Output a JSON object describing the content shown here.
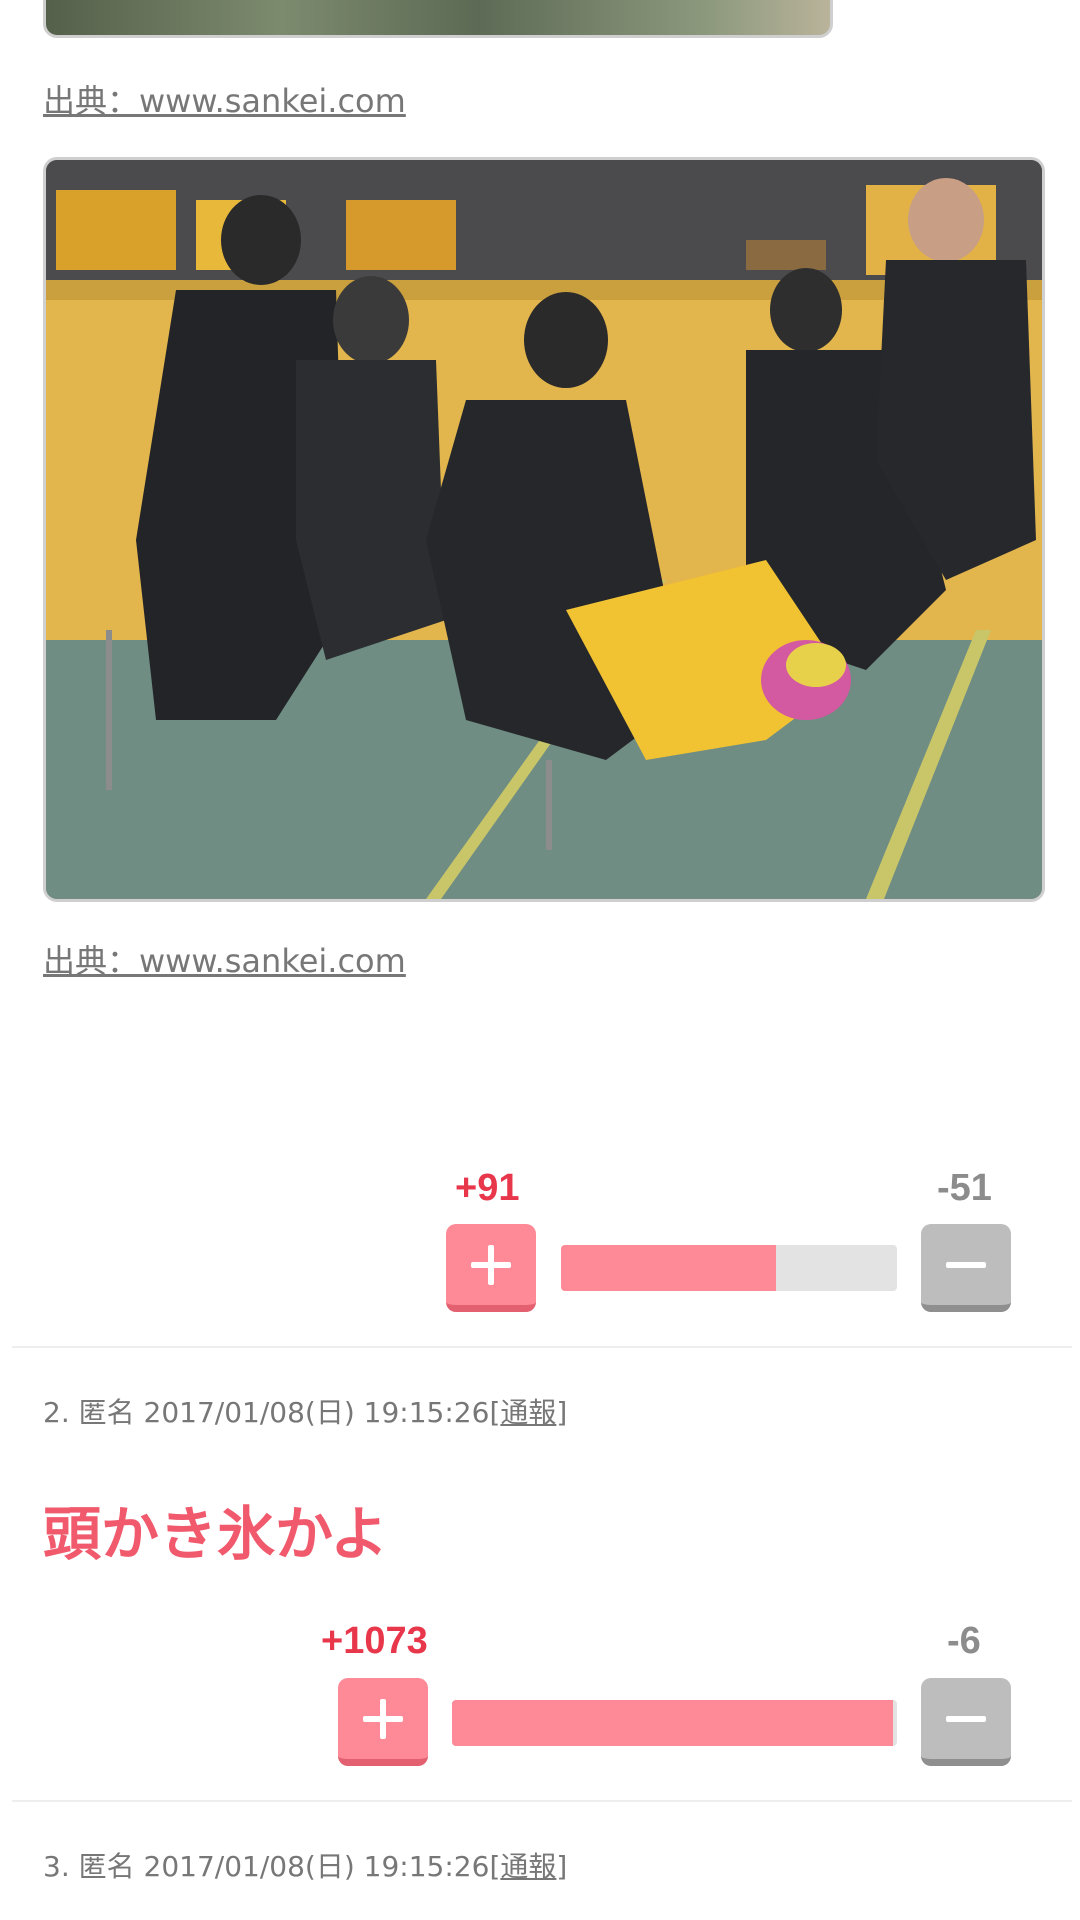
{
  "images": [
    {
      "source_label": "出典：www.sankei.com"
    },
    {
      "source_label": "出典：www.sankei.com"
    }
  ],
  "comments": [
    {
      "votes": {
        "plus": "+91",
        "minus": "-51",
        "plus_ratio": 0.64
      }
    },
    {
      "meta": {
        "number": "2.",
        "name": "匿名",
        "datetime": "2017/01/08(日) 19:15:26",
        "report_prefix": "[",
        "report": "通報",
        "report_suffix": "]"
      },
      "body": "頭かき氷かよ",
      "votes": {
        "plus": "+1073",
        "minus": "-6",
        "plus_ratio": 0.99
      }
    },
    {
      "meta": {
        "number": "3.",
        "name": "匿名",
        "datetime": "2017/01/08(日) 19:15:26",
        "report_prefix": "[",
        "report": "通報",
        "report_suffix": "]"
      }
    }
  ],
  "colors": {
    "accent": "#f05a6c",
    "plus": "#ff8a97",
    "minus": "#bdbdbd"
  }
}
